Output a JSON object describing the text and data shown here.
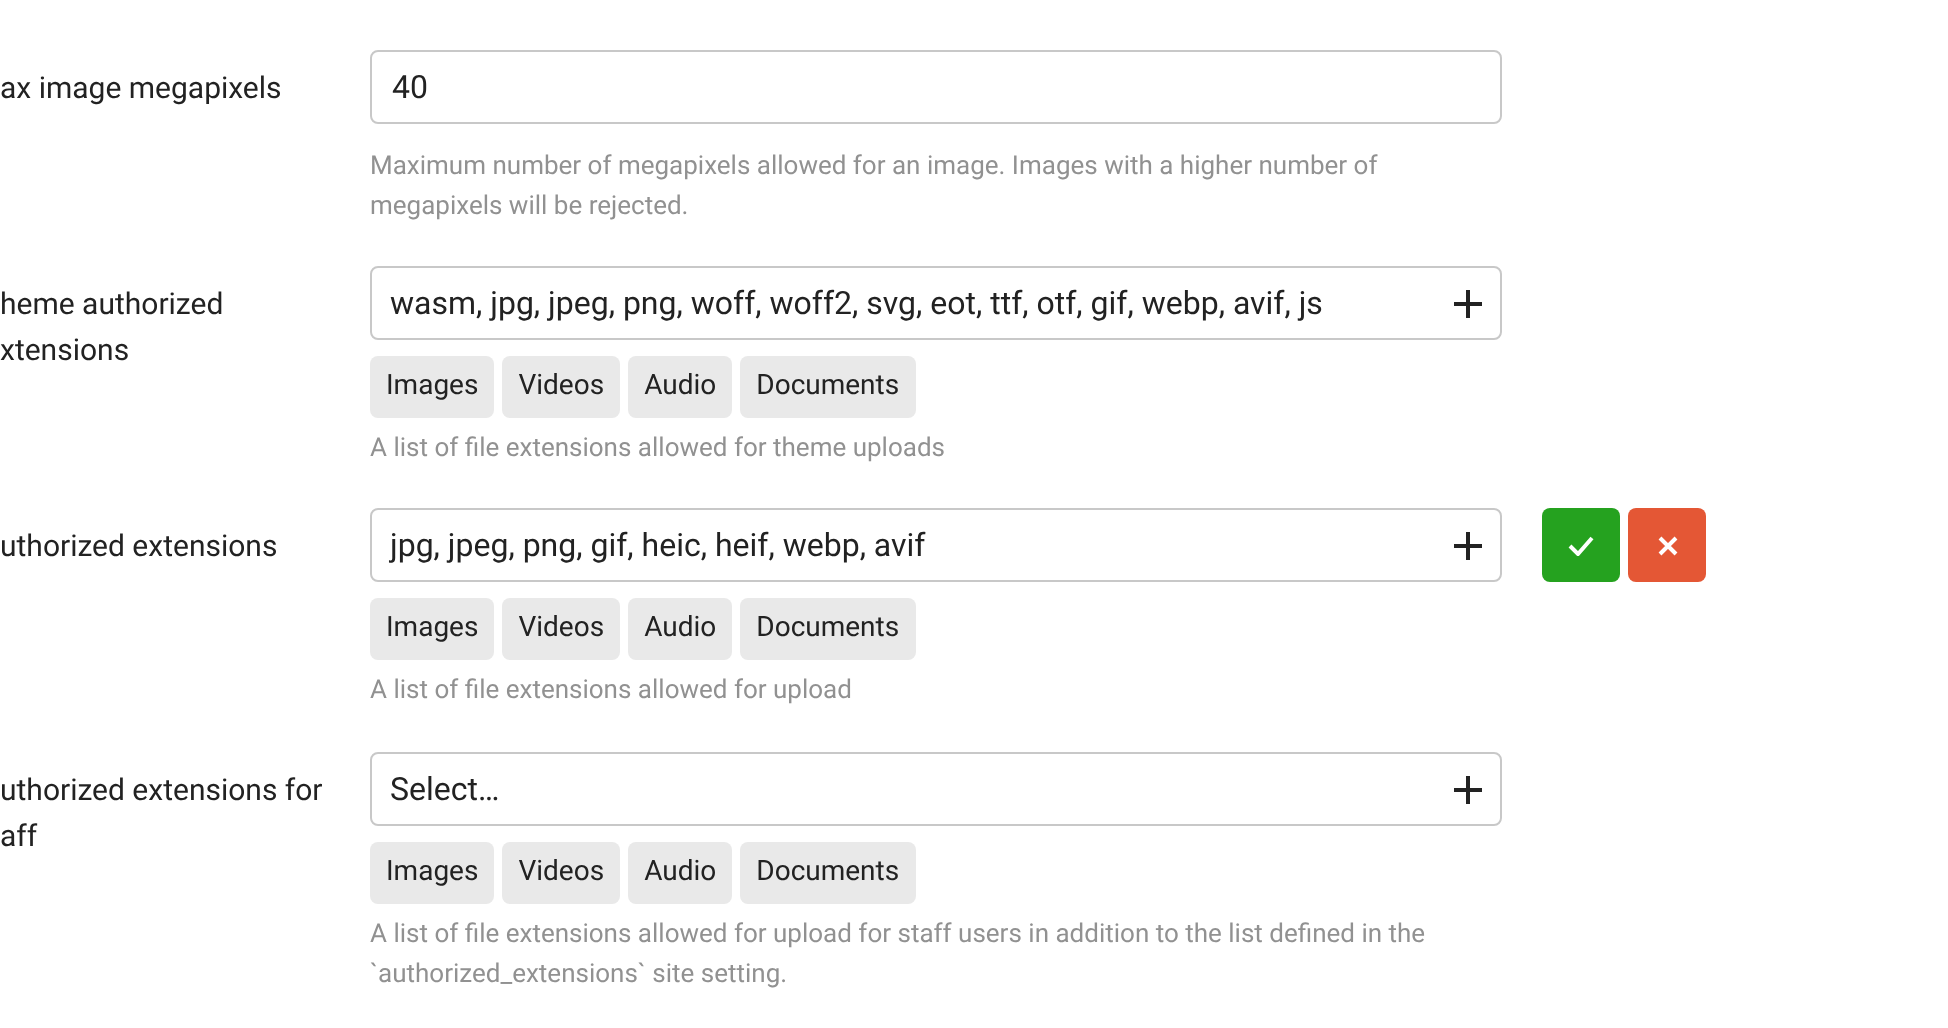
{
  "settings": [
    {
      "label_lines": [
        "ax image megapixels"
      ],
      "kind": "text",
      "value": "40",
      "help": "Maximum number of megapixels allowed for an image. Images with a higher number of megapixels will be rejected.",
      "dirty": false
    },
    {
      "label_lines": [
        "heme authorized",
        "xtensions"
      ],
      "kind": "list",
      "value": "wasm, jpg, jpeg, png, woff, woff2, svg, eot, ttf, otf, gif, webp, avif, js",
      "presets": [
        "Images",
        "Videos",
        "Audio",
        "Documents"
      ],
      "help": "A list of file extensions allowed for theme uploads",
      "dirty": false
    },
    {
      "label_lines": [
        "uthorized extensions"
      ],
      "kind": "list",
      "value": "jpg, jpeg, png, gif, heic, heif, webp, avif",
      "presets": [
        "Images",
        "Videos",
        "Audio",
        "Documents"
      ],
      "help": "A list of file extensions allowed for upload",
      "dirty": true
    },
    {
      "label_lines": [
        "uthorized extensions for",
        "aff"
      ],
      "kind": "list",
      "placeholder": "Select…",
      "presets": [
        "Images",
        "Videos",
        "Audio",
        "Documents"
      ],
      "help": "A list of file extensions allowed for upload for staff users in addition to the list defined in the `authorized_extensions` site setting.",
      "dirty": false
    }
  ]
}
